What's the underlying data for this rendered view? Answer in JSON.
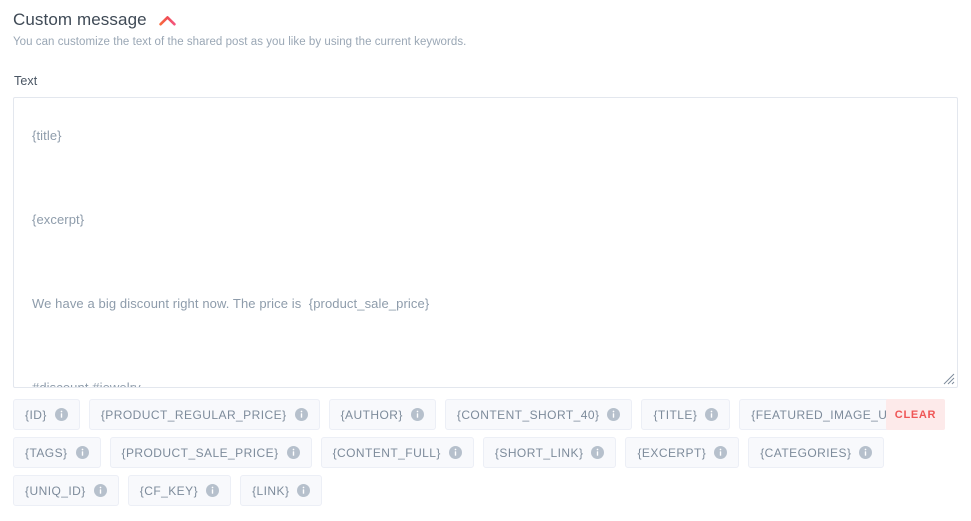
{
  "panel": {
    "title": "Custom message",
    "collapse_icon": "chevron-up-icon",
    "subtitle": "You can customize the text of the shared post as you like by using the current keywords.",
    "accent_color": "#f2575f",
    "text_muted_color": "#9aa7b5"
  },
  "text_field": {
    "label": "Text",
    "value": "{title}\n\n{excerpt}\n\nWe have a big discount right now. The price is  {product_sale_price}\n\n#discount #jewelry",
    "placeholder": ""
  },
  "keyword_chips": {
    "info_icon": "info-icon",
    "rows": [
      [
        {
          "label": "{ID}"
        },
        {
          "label": "{PRODUCT_REGULAR_PRICE}"
        },
        {
          "label": "{AUTHOR}"
        },
        {
          "label": "{CONTENT_SHORT_40}"
        },
        {
          "label": "{TITLE}"
        },
        {
          "label": "{FEATURED_IMAGE_URL}"
        }
      ],
      [
        {
          "label": "{TAGS}"
        },
        {
          "label": "{PRODUCT_SALE_PRICE}"
        },
        {
          "label": "{CONTENT_FULL}"
        },
        {
          "label": "{SHORT_LINK}"
        },
        {
          "label": "{EXCERPT}"
        },
        {
          "label": "{CATEGORIES}"
        }
      ],
      [
        {
          "label": "{UNIQ_ID}"
        },
        {
          "label": "{CF_KEY}"
        },
        {
          "label": "{LINK}"
        }
      ]
    ]
  },
  "clear_button": {
    "label": "CLEAR",
    "bg_color": "#fdeaea",
    "text_color": "#ef5656"
  }
}
